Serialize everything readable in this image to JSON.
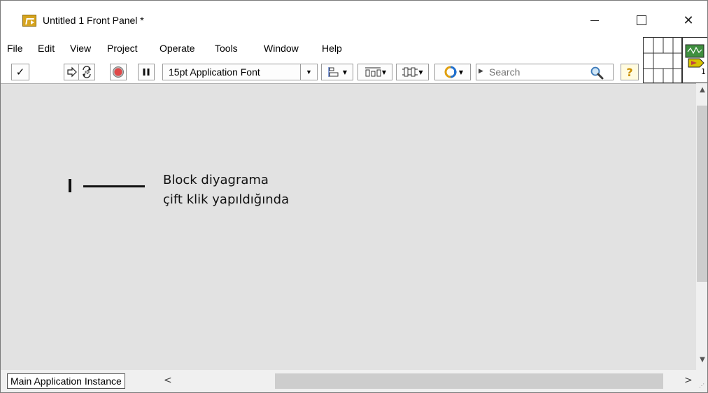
{
  "window": {
    "title": "Untitled 1 Front Panel *",
    "controls": {
      "minimize": "—",
      "maximize": "☐",
      "close": "✕"
    }
  },
  "menu": {
    "items": [
      "File",
      "Edit",
      "View",
      "Project",
      "Operate",
      "Tools",
      "Window",
      "Help"
    ]
  },
  "toolbar": {
    "run_check": "✓",
    "font_selector": "15pt Application Font",
    "search_placeholder": "Search",
    "help": "?"
  },
  "panel": {
    "annotation_line1": "Block diyagrama",
    "annotation_line2": "çift klik yapıldığında",
    "background_color": "#e2e2e2"
  },
  "status": {
    "context": "Main Application Instance",
    "scroll_left": "<",
    "scroll_right": ">"
  },
  "icons": {
    "app": "labview-icon",
    "search": "magnifier-icon",
    "help": "help-icon"
  }
}
